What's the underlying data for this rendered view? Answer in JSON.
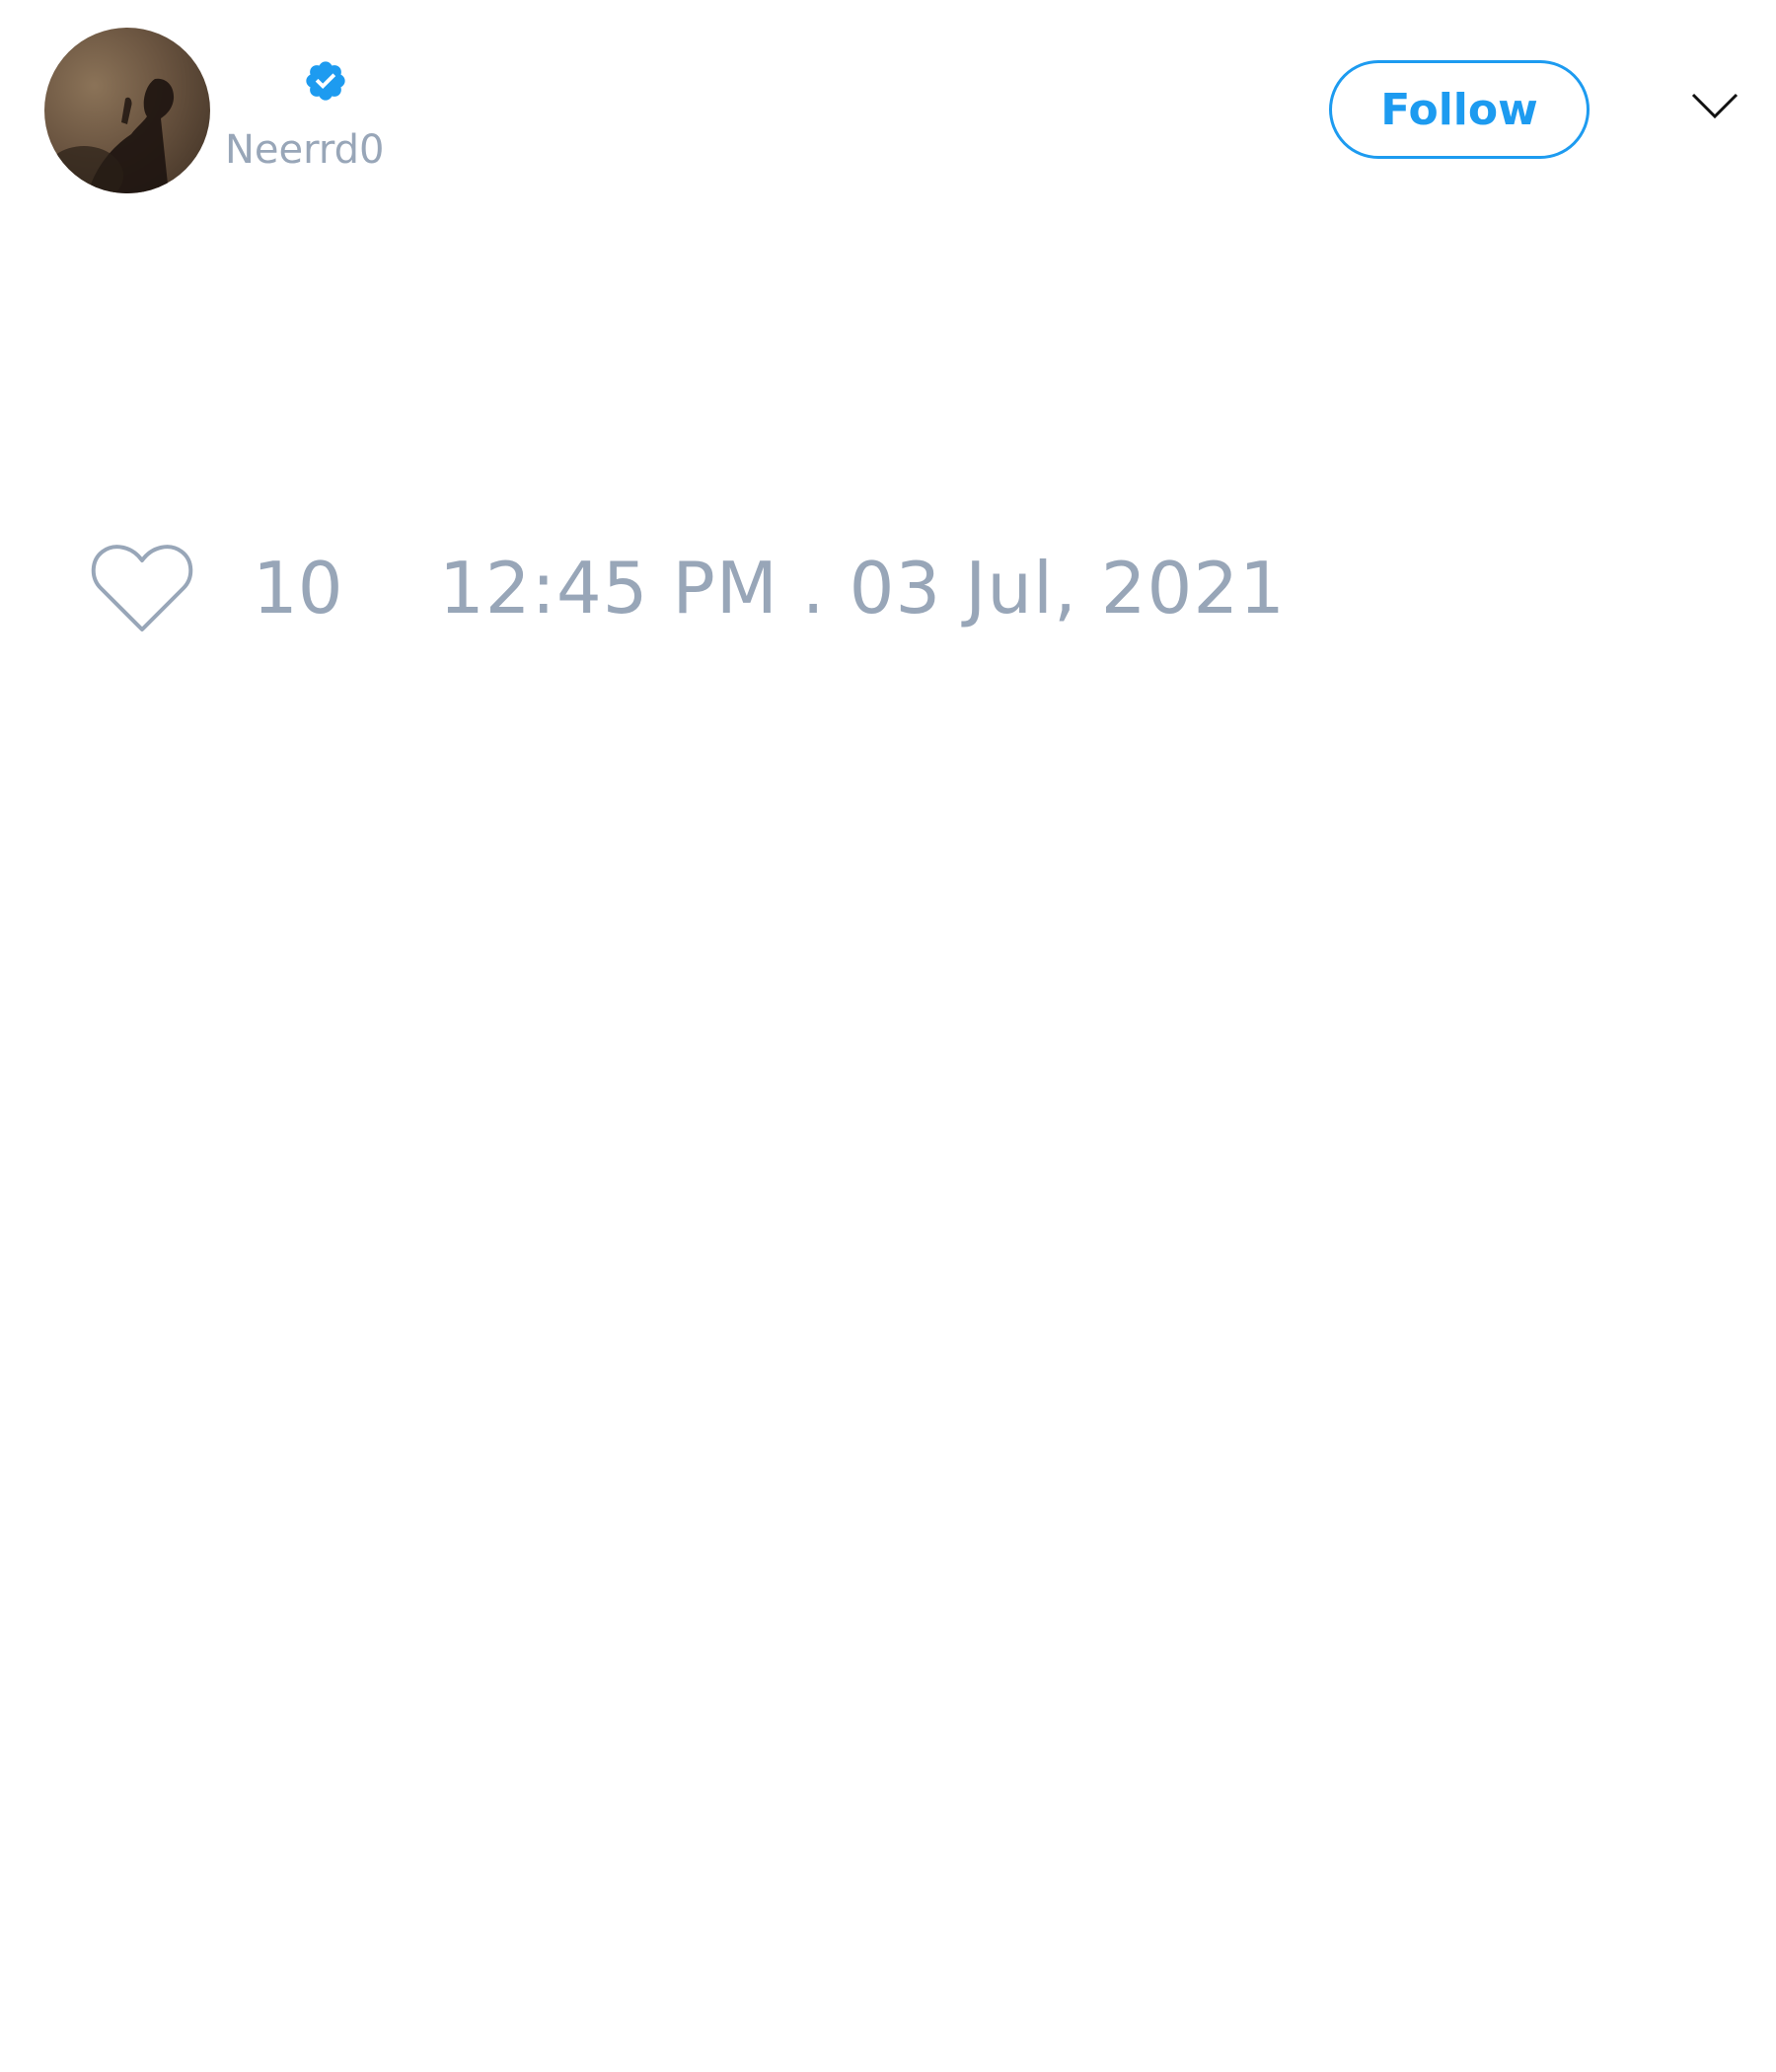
{
  "author": {
    "handle": "Neerrd0",
    "verified": true,
    "avatar_icon": "avatar-image"
  },
  "follow_button": {
    "label": "Follow"
  },
  "menu": {
    "icon": "chevron-down-icon"
  },
  "engagement": {
    "like_icon": "heart-outline-icon",
    "like_count": "10"
  },
  "timestamp": "12:45 PM . 03 Jul, 2021",
  "colors": {
    "accent": "#1d9bf0",
    "muted_text": "#98a6b8",
    "background": "#ffffff"
  }
}
